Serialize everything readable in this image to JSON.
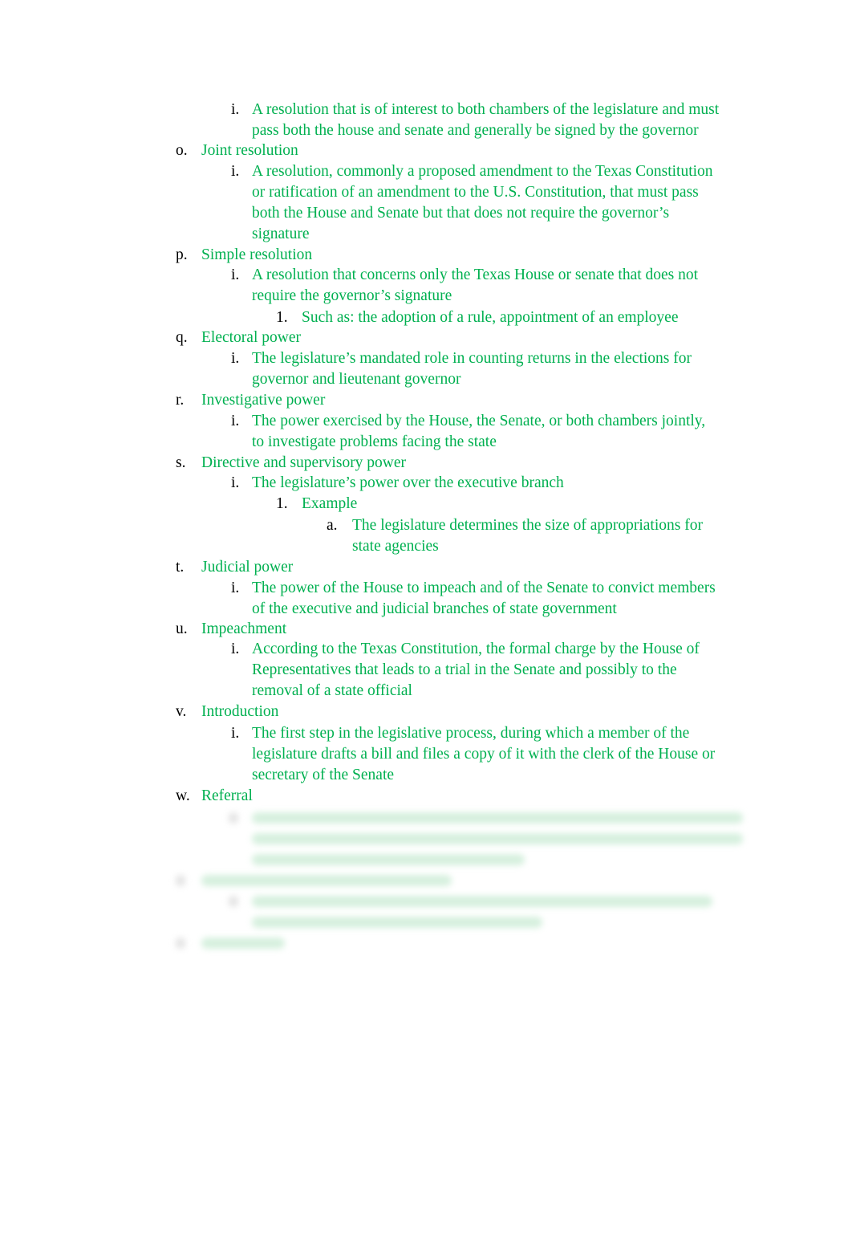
{
  "colors": {
    "text": "#00b050",
    "marker": "#000000"
  },
  "items": [
    {
      "marker": "i.",
      "text": [
        "A resolution that is of interest to both chambers of the legislature and must",
        "pass both the house and senate and generally be signed by the governor"
      ]
    },
    {
      "marker": "o.",
      "text": [
        "Joint resolution"
      ]
    },
    {
      "marker": "i.",
      "text": [
        "A resolution, commonly a proposed amendment to the Texas Constitution",
        "or ratification of an amendment to the U.S. Constitution, that must pass",
        "both the House and Senate but that does not require the governor’s",
        "signature"
      ]
    },
    {
      "marker": "p.",
      "text": [
        "Simple resolution"
      ]
    },
    {
      "marker": "i.",
      "text": [
        "A resolution that concerns only the Texas House or senate that does not",
        "require the governor’s signature"
      ]
    },
    {
      "marker": "1.",
      "text": [
        "Such as: the adoption of a rule, appointment of an employee"
      ]
    },
    {
      "marker": "q.",
      "text": [
        "Electoral power"
      ]
    },
    {
      "marker": "i.",
      "text": [
        "The legislature’s mandated role in counting returns in the elections for",
        "governor and lieutenant governor"
      ]
    },
    {
      "marker": "r.",
      "text": [
        "Investigative power"
      ]
    },
    {
      "marker": "i.",
      "text": [
        "The power exercised by the House, the Senate, or both chambers jointly,",
        "to investigate problems facing the state"
      ]
    },
    {
      "marker": "s.",
      "text": [
        "Directive and supervisory power"
      ]
    },
    {
      "marker": "i.",
      "text": [
        "The legislature’s power over the executive branch"
      ]
    },
    {
      "marker": "1.",
      "text": [
        "Example"
      ]
    },
    {
      "marker": "a.",
      "text": [
        "The legislature determines the size of appropriations for",
        "state agencies"
      ]
    },
    {
      "marker": "t.",
      "text": [
        "Judicial power"
      ]
    },
    {
      "marker": "i.",
      "text": [
        "The power of the House to impeach and of the Senate to convict members",
        "of the executive and judicial branches of state government"
      ]
    },
    {
      "marker": "u.",
      "text": [
        "Impeachment"
      ]
    },
    {
      "marker": "i.",
      "text": [
        "According to the Texas Constitution, the formal charge by the House of",
        "Representatives that leads to a trial in the Senate and possibly to the",
        "removal of a state official"
      ]
    },
    {
      "marker": "v.",
      "text": [
        "Introduction"
      ]
    },
    {
      "marker": "i.",
      "text": [
        "The first step in the legislative process, during which a member of the",
        "legislature drafts a bill and files a copy of it with the clerk of the House or",
        "secretary of the Senate"
      ]
    },
    {
      "marker": "w.",
      "text": [
        "Referral"
      ]
    }
  ]
}
